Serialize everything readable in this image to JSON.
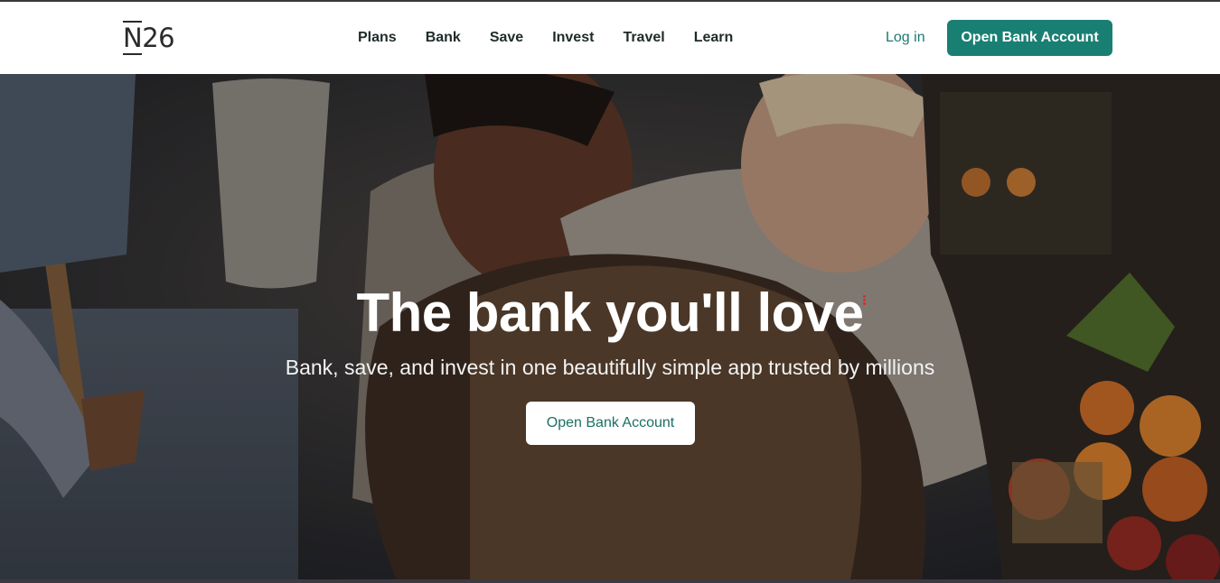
{
  "brand": {
    "logo_text": "N26",
    "accent_color": "#1a7f73"
  },
  "nav": {
    "items": [
      "Plans",
      "Bank",
      "Save",
      "Invest",
      "Travel",
      "Learn"
    ]
  },
  "header": {
    "login_label": "Log in",
    "cta_label": "Open Bank Account"
  },
  "hero": {
    "headline": "The bank you'll love",
    "subheadline": "Bank, save, and invest in one beautifully simple app trusted by millions",
    "button_label": "Open Bank Account",
    "background": "photo of friends smiling at a market"
  }
}
